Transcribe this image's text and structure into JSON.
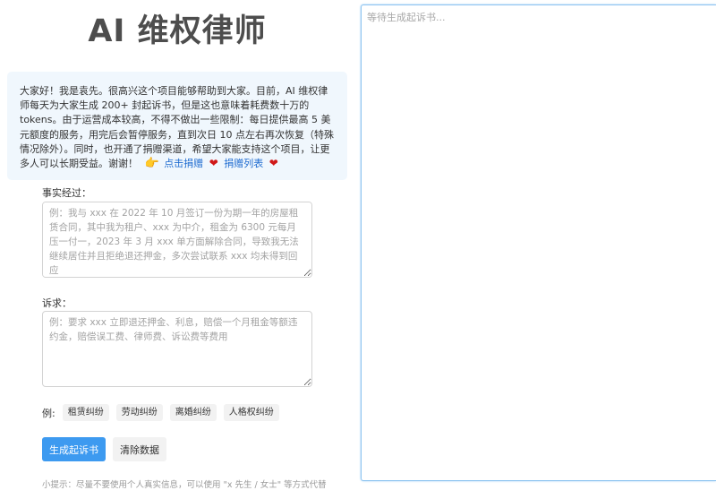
{
  "header": {
    "title": "AI 维权律师"
  },
  "intro": {
    "text": "大家好！我是袁先。很高兴这个项目能够帮助到大家。目前，AI 维权律师每天为大家生成 200+ 封起诉书，但是这也意味着耗费数十万的 tokens。由于运营成本较高，不得不做出一些限制：每日提供最高 5 美元额度的服务，用完后会暂停服务，直到次日 10 点左右再次恢复（特殊情况除外）。同时，也开通了捐赠渠道，希望大家能支持这个项目，让更多人可以长期受益。谢谢！",
    "donate_link": "点击捐赠",
    "donation_list_link": "捐赠列表",
    "hand_icon": "👉",
    "heart_icon": "❤"
  },
  "facts": {
    "label": "事实经过：",
    "placeholder": "例：我与 xxx 在 2022 年 10 月签订一份为期一年的房屋租赁合同，其中我为租户、xxx 为中介，租金为 6300 元每月压一付一，2023 年 3 月 xxx 单方面解除合同，导致我无法继续居住并且拒绝退还押金，多次尝试联系 xxx 均未得到回应"
  },
  "claims": {
    "label": "诉求：",
    "placeholder": "例：要求 xxx 立即退还押金、利息，赔偿一个月租金等额违约金，赔偿误工费、律师费、诉讼费等费用"
  },
  "examples": {
    "label": "例:",
    "items": [
      "租赁纠纷",
      "劳动纠纷",
      "离婚纠纷",
      "人格权纠纷"
    ]
  },
  "actions": {
    "generate_label": "生成起诉书",
    "clear_label": "清除数据"
  },
  "hint": {
    "text": "小提示：尽量不要使用个人真实信息，可以使用 \"x 先生 / 女士\" 等方式代替"
  },
  "output": {
    "placeholder": "等待生成起诉书..."
  },
  "colors": {
    "primary": "#3d9af0",
    "link": "#1e6bd0",
    "intro_bg": "#f0f7fd",
    "title": "#4d4d4d"
  }
}
